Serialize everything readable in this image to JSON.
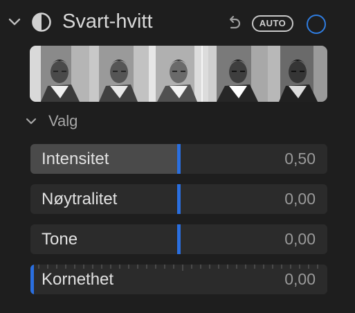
{
  "header": {
    "title": "Svart-hvitt",
    "auto_label": "AUTO",
    "disclosure_icon": "chevron-down-icon",
    "effect_icon": "half-circle-icon",
    "undo_icon": "undo-arrow-icon",
    "enable_icon": "toggle-circle-icon",
    "accent_color": "#2f7de1"
  },
  "filmstrip": {
    "thumbnails": [
      {
        "tone": "light"
      },
      {
        "tone": "neutral"
      },
      {
        "tone": "bright"
      },
      {
        "tone": "contrast"
      },
      {
        "tone": "dark"
      }
    ]
  },
  "section": {
    "label": "Valg"
  },
  "sliders": [
    {
      "label": "Intensitet",
      "value": "0,50",
      "level": 0.5
    },
    {
      "label": "Nøytralitet",
      "value": "0,00",
      "level": 0.5
    },
    {
      "label": "Tone",
      "value": "0,00",
      "level": 0.5
    },
    {
      "label": "Kornethet",
      "value": "0,00",
      "level": 0.0
    }
  ]
}
